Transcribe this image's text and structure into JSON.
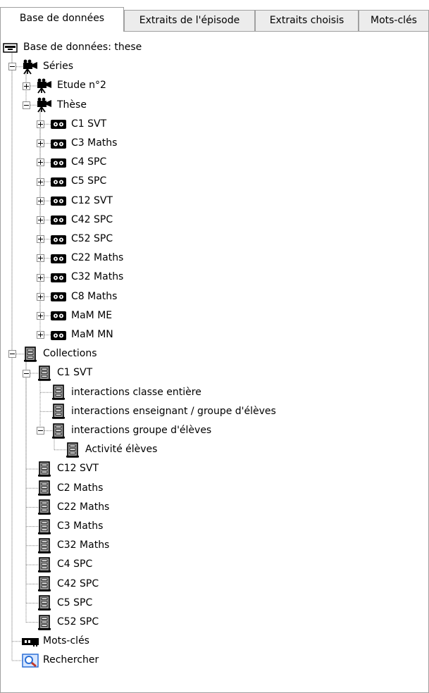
{
  "tabs": [
    {
      "label": "Base de données",
      "active": true
    },
    {
      "label": "Extraits de l'épisode",
      "active": false
    },
    {
      "label": "Extraits choisis",
      "active": false
    },
    {
      "label": "Mots-clés",
      "active": false
    }
  ],
  "tree": [
    {
      "label": "Base de données: these",
      "icon": "database-icon",
      "level": 0,
      "expander": "none"
    },
    {
      "label": "Séries",
      "icon": "camera-icon",
      "level": 1,
      "expander": "minus"
    },
    {
      "label": "Etude n°2",
      "icon": "camera-icon",
      "level": 2,
      "expander": "plus"
    },
    {
      "label": "Thèse",
      "icon": "camera-icon",
      "level": 2,
      "expander": "minus"
    },
    {
      "label": "C1 SVT",
      "icon": "videotape-icon",
      "level": 3,
      "expander": "plus"
    },
    {
      "label": "C3 Maths",
      "icon": "videotape-icon",
      "level": 3,
      "expander": "plus"
    },
    {
      "label": "C4 SPC",
      "icon": "videotape-icon",
      "level": 3,
      "expander": "plus"
    },
    {
      "label": "C5 SPC",
      "icon": "videotape-icon",
      "level": 3,
      "expander": "plus"
    },
    {
      "label": "C12 SVT",
      "icon": "videotape-icon",
      "level": 3,
      "expander": "plus"
    },
    {
      "label": "C42 SPC",
      "icon": "videotape-icon",
      "level": 3,
      "expander": "plus"
    },
    {
      "label": "C52 SPC",
      "icon": "videotape-icon",
      "level": 3,
      "expander": "plus"
    },
    {
      "label": "C22 Maths",
      "icon": "videotape-icon",
      "level": 3,
      "expander": "plus"
    },
    {
      "label": "C32 Maths",
      "icon": "videotape-icon",
      "level": 3,
      "expander": "plus"
    },
    {
      "label": "C8 Maths",
      "icon": "videotape-icon",
      "level": 3,
      "expander": "plus"
    },
    {
      "label": "MaM ME",
      "icon": "videotape-icon",
      "level": 3,
      "expander": "plus"
    },
    {
      "label": "MaM MN",
      "icon": "videotape-icon",
      "level": 3,
      "expander": "plus"
    },
    {
      "label": "Collections",
      "icon": "collection-icon",
      "level": 1,
      "expander": "minus"
    },
    {
      "label": "C1 SVT",
      "icon": "collection-icon",
      "level": 2,
      "expander": "minus"
    },
    {
      "label": "interactions classe entière",
      "icon": "collection-icon",
      "level": 3,
      "expander": "none"
    },
    {
      "label": "interactions enseignant / groupe d'élèves",
      "icon": "collection-icon",
      "level": 3,
      "expander": "none"
    },
    {
      "label": "interactions groupe d'élèves",
      "icon": "collection-icon",
      "level": 3,
      "expander": "minus"
    },
    {
      "label": "Activité élèves",
      "icon": "collection-icon",
      "level": 4,
      "expander": "none"
    },
    {
      "label": "C12 SVT",
      "icon": "collection-icon",
      "level": 2,
      "expander": "none"
    },
    {
      "label": "C2 Maths",
      "icon": "collection-icon",
      "level": 2,
      "expander": "none"
    },
    {
      "label": "C22 Maths",
      "icon": "collection-icon",
      "level": 2,
      "expander": "none"
    },
    {
      "label": "C3 Maths",
      "icon": "collection-icon",
      "level": 2,
      "expander": "none"
    },
    {
      "label": "C32 Maths",
      "icon": "collection-icon",
      "level": 2,
      "expander": "none"
    },
    {
      "label": "C4 SPC",
      "icon": "collection-icon",
      "level": 2,
      "expander": "none"
    },
    {
      "label": "C42 SPC",
      "icon": "collection-icon",
      "level": 2,
      "expander": "none"
    },
    {
      "label": "C5 SPC",
      "icon": "collection-icon",
      "level": 2,
      "expander": "none"
    },
    {
      "label": "C52 SPC",
      "icon": "collection-icon",
      "level": 2,
      "expander": "none"
    },
    {
      "label": "Mots-clés",
      "icon": "key-icon",
      "level": 1,
      "expander": "none"
    },
    {
      "label": "Rechercher",
      "icon": "search-icon",
      "level": 1,
      "expander": "none"
    }
  ],
  "colors": {
    "tab_border": "#a0a0a0",
    "tab_inactive_bg": "#ececec",
    "tree_line": "#808080",
    "search_icon_blue": "#2a6fd6"
  }
}
